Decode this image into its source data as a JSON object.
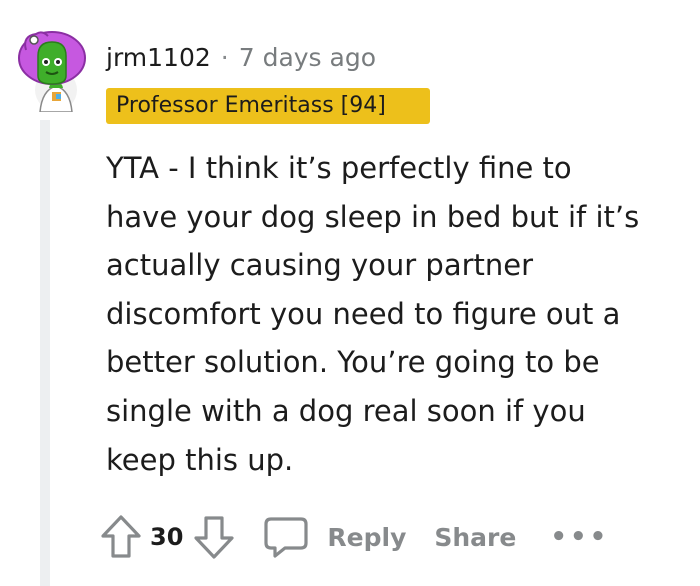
{
  "comment": {
    "username": "jrm1102",
    "separator": "·",
    "timestamp": "7 days ago",
    "flair": "Professor Emeritass [94]",
    "body": "YTA - I think it’s perfectly fine to\nhave your dog sleep in bed but if it’s\nactually causing your partner\ndiscomfort you need to figure out a\nbetter solution. You’re going to be\nsingle with a dog real soon if you\nkeep this up.",
    "vote_count": "30",
    "reply_label": "Reply",
    "share_label": "Share",
    "more_label": "•••"
  },
  "icons": {
    "avatar": "avatar-icon",
    "upvote": "arrow-up-icon",
    "downvote": "arrow-down-icon",
    "reply": "speech-bubble-icon"
  },
  "colors": {
    "flair_background": "#edc01b",
    "action_gray": "#878a8c",
    "thread_line": "#edeff1",
    "avatar_purple": "#c658e0",
    "avatar_green": "#3fae2a"
  }
}
